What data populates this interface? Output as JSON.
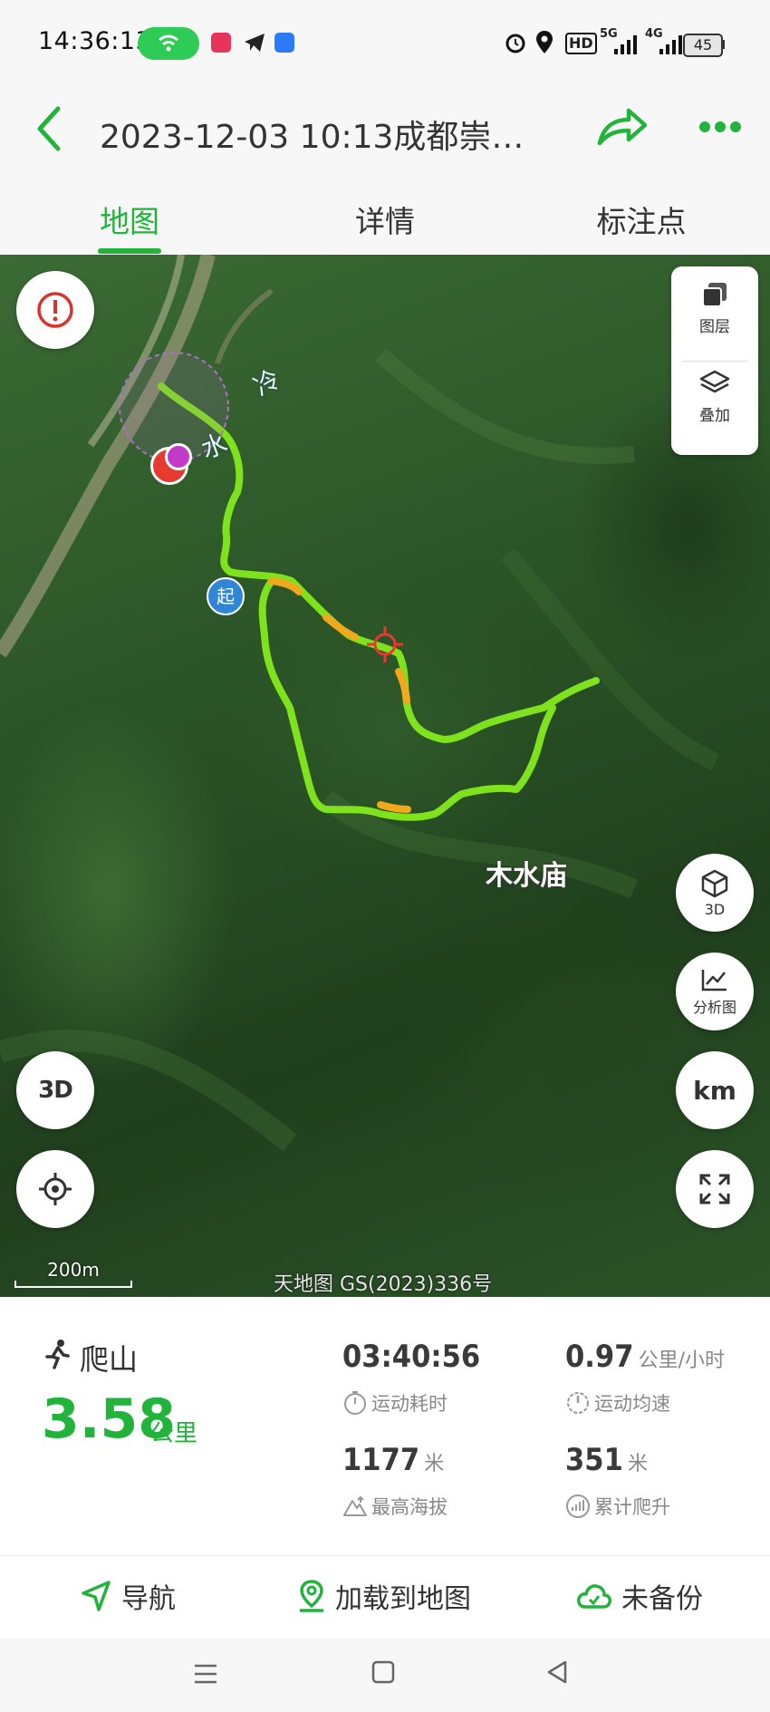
{
  "status_bar": {
    "time": "14:36:13",
    "hd_label": "HD",
    "net_5g": "5G",
    "net_4g": "4G",
    "battery": "45"
  },
  "header": {
    "title": "2023-12-03 10:13成都崇…",
    "tabs": [
      "地图",
      "详情",
      "标注点"
    ],
    "active_tab": 0
  },
  "map": {
    "layer_panel": {
      "layers_label": "图层",
      "overlay_label": "叠加"
    },
    "buttons": {
      "view_3d_label": "3D",
      "analysis_label": "分析图",
      "km_label": "km",
      "three_d_mode_label": "3D"
    },
    "start_marker": "起",
    "scale_label": "200m",
    "attribution": "天地图 GS(2023)336号",
    "place_label": "木水庙",
    "place_labels_small": [
      "冷",
      "水"
    ]
  },
  "stats": {
    "activity_type": "爬山",
    "distance_value": "3.58",
    "distance_unit": "公里",
    "duration_value": "03:40:56",
    "duration_label": "运动耗时",
    "speed_value": "0.97",
    "speed_unit": "公里/小时",
    "speed_label": "运动均速",
    "max_alt_value": "1177",
    "max_alt_unit": "米",
    "max_alt_label": "最高海拔",
    "climb_value": "351",
    "climb_unit": "米",
    "climb_label": "累计爬升"
  },
  "actions": {
    "navigate": "导航",
    "load_to_map": "加载到地图",
    "backup": "未备份"
  },
  "colors": {
    "accent": "#22b33a",
    "track_main": "#7ee21c",
    "track_warm": "#f2a81d"
  }
}
